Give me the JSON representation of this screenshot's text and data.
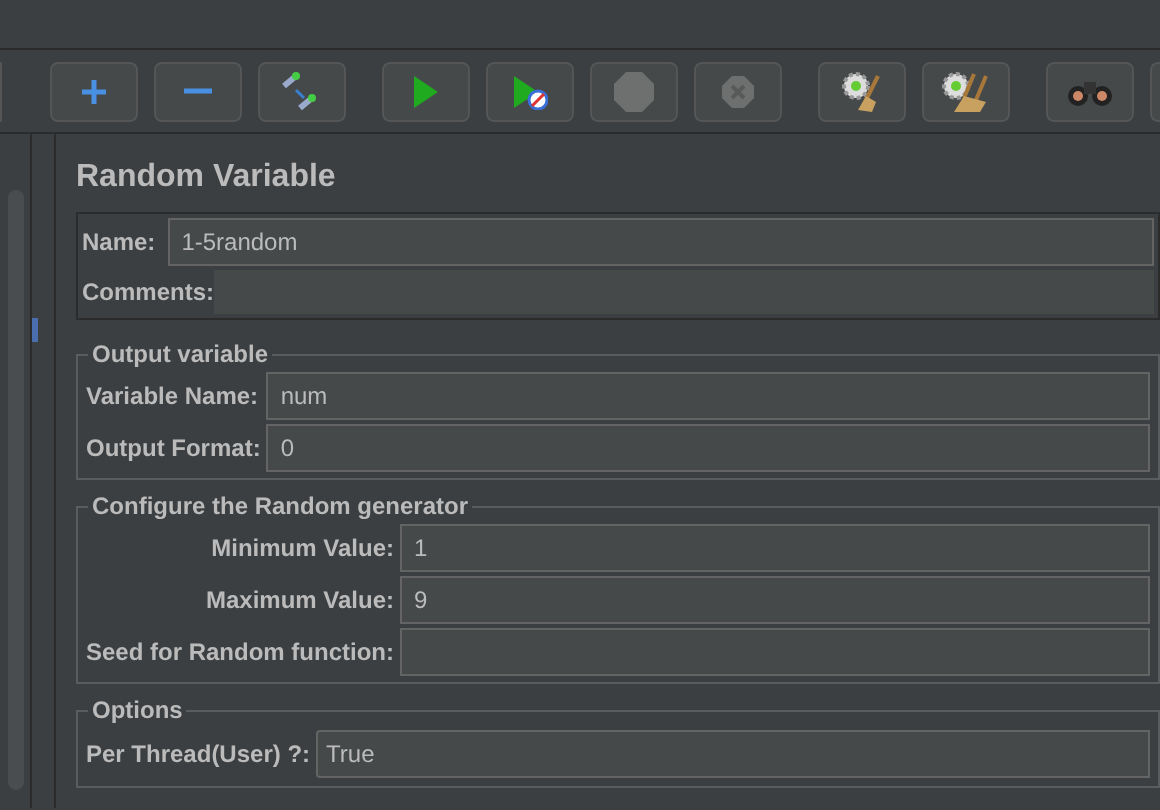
{
  "toolbar": [
    {
      "disabled": false
    },
    {
      "disabled": false
    },
    {
      "disabled": false
    },
    {
      "disabled": false
    },
    {
      "disabled": false
    },
    {
      "disabled": true
    },
    {
      "disabled": true
    },
    {
      "disabled": false
    },
    {
      "disabled": false
    },
    {
      "disabled": false
    }
  ],
  "panel": {
    "title": "Random Variable",
    "name": {
      "label": "Name:",
      "value": "1-5random"
    },
    "comments": {
      "label": "Comments:"
    },
    "sections": [
      {
        "title": "Output variable",
        "fields": [
          {
            "label": "Variable Name:",
            "value": "num"
          },
          {
            "label": "Output Format:",
            "value": "0"
          }
        ]
      },
      {
        "title": "Configure the Random generator",
        "fields": [
          {
            "label": "Minimum Value:",
            "value": "1"
          },
          {
            "label": "Maximum Value:",
            "value": "9"
          },
          {
            "label": "Seed for Random function:"
          }
        ]
      }
    ],
    "options": {
      "title": "Options",
      "label": "Per Thread(User) ?:",
      "value": "True"
    }
  }
}
